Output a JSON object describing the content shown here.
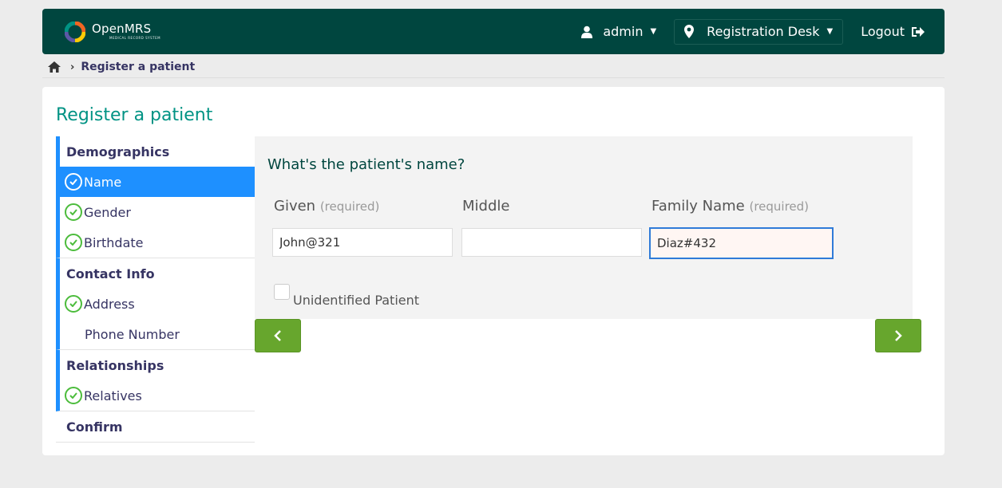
{
  "header": {
    "logo_name": "OpenMRS",
    "logo_tagline": "MEDICAL RECORD SYSTEM",
    "user": "admin",
    "location": "Registration Desk",
    "logout": "Logout"
  },
  "breadcrumb": {
    "home_icon": "home-icon",
    "current": "Register a patient"
  },
  "page": {
    "title": "Register a patient"
  },
  "sidebar": {
    "sections": [
      {
        "title": "Demographics",
        "items": [
          {
            "label": "Name",
            "checked": true,
            "active": true
          },
          {
            "label": "Gender",
            "checked": true,
            "active": false
          },
          {
            "label": "Birthdate",
            "checked": true,
            "active": false
          }
        ]
      },
      {
        "title": "Contact Info",
        "items": [
          {
            "label": "Address",
            "checked": true,
            "active": false
          },
          {
            "label": "Phone Number",
            "checked": false,
            "active": false
          }
        ]
      },
      {
        "title": "Relationships",
        "items": [
          {
            "label": "Relatives",
            "checked": true,
            "active": false
          }
        ]
      },
      {
        "title": "Confirm",
        "items": []
      }
    ]
  },
  "form": {
    "question": "What's the patient's name?",
    "given": {
      "label": "Given",
      "required_hint": "(required)",
      "value": "John@321"
    },
    "middle": {
      "label": "Middle",
      "value": ""
    },
    "family": {
      "label": "Family Name",
      "required_hint": "(required)",
      "value": "Diaz#432"
    },
    "unidentified_label": "Unidentified Patient",
    "unidentified_checked": false
  },
  "colors": {
    "header_bg": "#00463f",
    "accent_teal": "#009384",
    "active_blue": "#1e90ff",
    "check_green": "#4cbc3c",
    "button_green": "#67a62d"
  },
  "icons": {
    "prev": "chevron-left-icon",
    "next": "chevron-right-icon",
    "user": "user-icon",
    "location": "map-marker-icon",
    "logout": "sign-out-icon",
    "check": "check-circle-icon"
  }
}
